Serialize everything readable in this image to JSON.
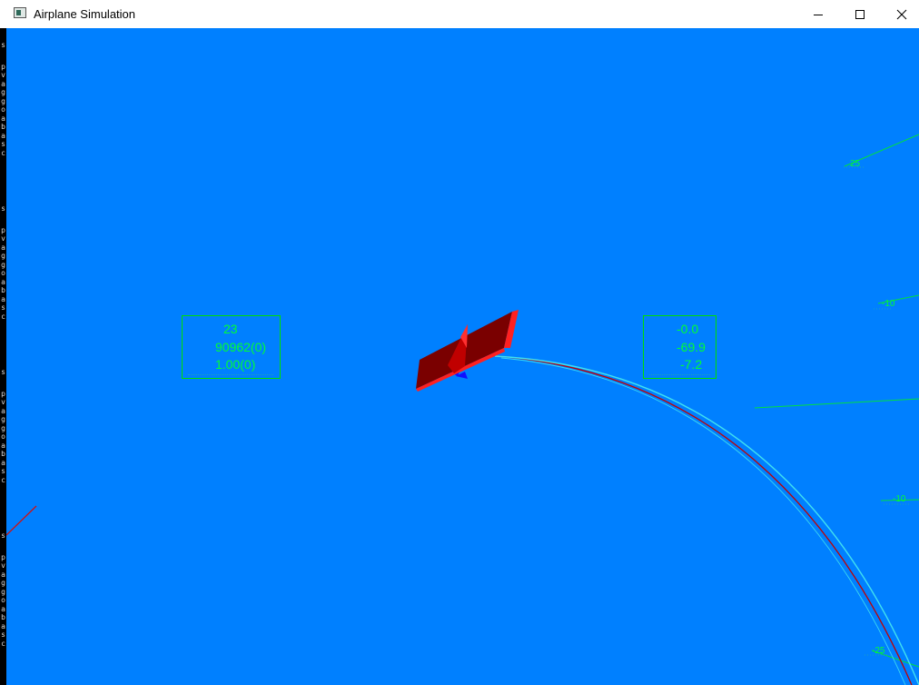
{
  "window": {
    "title": "Airplane Simulation",
    "icons": {
      "app": "app-window-icon",
      "minimize": "minimize-icon",
      "maximize": "maximize-icon",
      "close": "close-icon"
    }
  },
  "sidebar": {
    "glyph_groups": [
      [
        "s",
        "p",
        "v",
        "a",
        "g",
        "g",
        "o",
        "a",
        "b",
        "a",
        "s",
        "c"
      ],
      [
        "s",
        "p",
        "v",
        "a",
        "g",
        "g",
        "o",
        "a",
        "b",
        "a",
        "s",
        "c"
      ],
      [
        "s",
        "p",
        "v",
        "a",
        "g",
        "g",
        "o",
        "a",
        "b",
        "a",
        "s",
        "c"
      ],
      [
        "s",
        "p",
        "v",
        "a",
        "g",
        "g",
        "o",
        "a",
        "b",
        "a",
        "s",
        "c"
      ]
    ]
  },
  "hud_left": {
    "lines": [
      "23",
      "90962(0)",
      "1.00(0)"
    ]
  },
  "hud_right": {
    "lines": [
      "-0.0",
      "-69.9",
      "-7.2"
    ]
  },
  "ladder_labels": [
    "25",
    "-10",
    "-10",
    "-25"
  ],
  "colors": {
    "sky": "#0080ff",
    "hud_green": "#00ff33",
    "trajectory": "#40e0f0",
    "wing": "#7a0000",
    "wing_edge": "#ff2020",
    "tail_blue": "#1010ff"
  }
}
